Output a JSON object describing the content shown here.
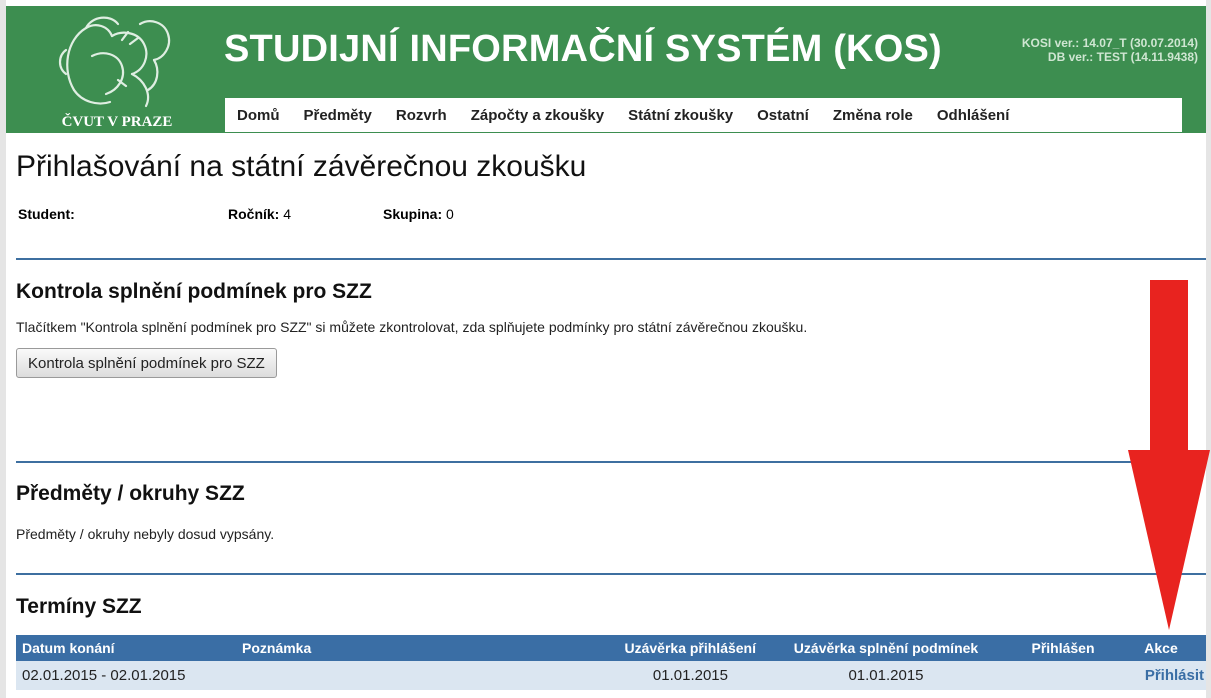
{
  "header": {
    "title": "STUDIJNÍ INFORMAČNÍ SYSTÉM (KOS)",
    "logo_text": "ČVUT V PRAZE",
    "version_line1": "KOSI ver.: 14.07_T (30.07.2014)",
    "version_line2": "DB ver.: TEST (14.11.9438)",
    "colors": {
      "header_bg": "#3d8e50",
      "table_header_bg": "#3a6ea5",
      "row_bg": "#dbe6f1",
      "annotation_arrow": "#e8231f"
    }
  },
  "nav": {
    "items": [
      "Domů",
      "Předměty",
      "Rozvrh",
      "Zápočty a zkoušky",
      "Státní zkoušky",
      "Ostatní",
      "Změna role",
      "Odhlášení"
    ]
  },
  "page": {
    "title": "Přihlašování na státní závěrečnou zkoušku",
    "student_label": "Student:",
    "student_value": "",
    "rocnik_label": "Ročník:",
    "rocnik_value": "4",
    "skupina_label": "Skupina:",
    "skupina_value": "0"
  },
  "kontrola": {
    "title": "Kontrola splnění podmínek pro SZZ",
    "text": "Tlačítkem \"Kontrola splnění podmínek pro SZZ\" si můžete zkontrolovat, zda splňujete podmínky pro státní závěrečnou zkoušku.",
    "button": "Kontrola splnění podmínek pro SZZ"
  },
  "predmety": {
    "title": "Předměty / okruhy SZZ",
    "text": "Předměty / okruhy nebyly dosud vypsány."
  },
  "terminy": {
    "title": "Termíny SZZ",
    "columns": [
      "Datum konání",
      "Poznámka",
      "Uzávěrka přihlášení",
      "Uzávěrka splnění podmínek",
      "Přihlášen",
      "Akce"
    ],
    "rows": [
      {
        "datum": "02.01.2015 - 02.01.2015",
        "poznamka": "",
        "uzaverka_prihlaseni": "01.01.2015",
        "uzaverka_splneni": "01.01.2015",
        "prihlasen": "",
        "akce": "Přihlásit"
      }
    ]
  }
}
